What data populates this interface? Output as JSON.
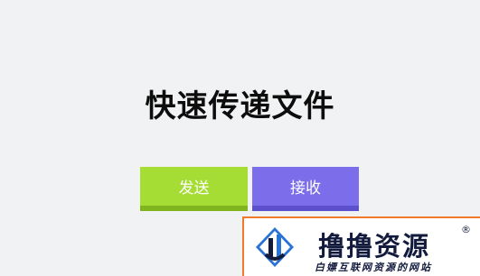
{
  "app": {
    "title": "快速传递文件"
  },
  "actions": {
    "send_label": "发送",
    "receive_label": "接收"
  },
  "colors": {
    "background": "#f1f2f3",
    "send_button": "#a5dd35",
    "receive_button": "#7c6eea"
  },
  "watermark": {
    "title": "撸撸资源",
    "registered_mark": "®",
    "subtitle": "白嫖互联网资源的网站",
    "logo_icon": "pipe-logo-icon"
  }
}
